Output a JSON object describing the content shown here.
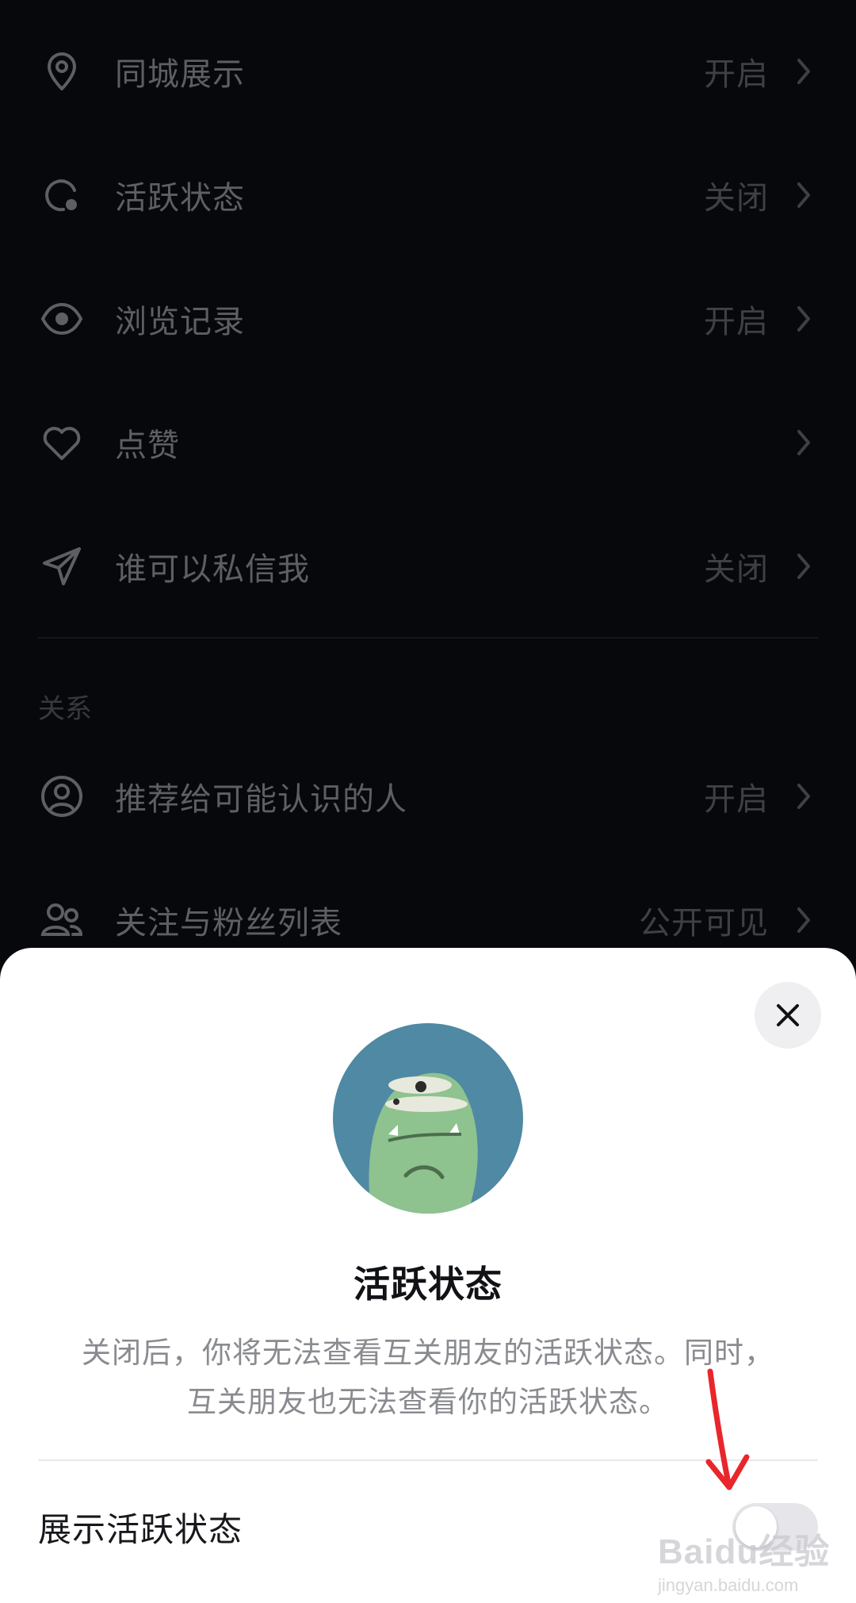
{
  "settings": {
    "rows": [
      {
        "label": "同城展示",
        "value": "开启",
        "icon": "location-pin-icon"
      },
      {
        "label": "活跃状态",
        "value": "关闭",
        "icon": "activity-status-icon"
      },
      {
        "label": "浏览记录",
        "value": "开启",
        "icon": "eye-icon"
      },
      {
        "label": "点赞",
        "value": "",
        "icon": "heart-icon"
      },
      {
        "label": "谁可以私信我",
        "value": "关闭",
        "icon": "paper-plane-icon"
      }
    ],
    "relations_section": "关系",
    "relations_rows": [
      {
        "label": "推荐给可能认识的人",
        "value": "开启",
        "icon": "user-circle-icon"
      },
      {
        "label": "关注与粉丝列表",
        "value": "公开可见",
        "icon": "users-icon"
      }
    ]
  },
  "sheet": {
    "title": "活跃状态",
    "description_line1": "关闭后，你将无法查看互关朋友的活跃状态。同时，",
    "description_line2": "互关朋友也无法查看你的活跃状态。",
    "toggle_label": "展示活跃状态",
    "toggle_on": false
  },
  "watermark": {
    "main": "Baidu经验",
    "sub": "jingyan.baidu.com"
  },
  "colors": {
    "background": "#07080b",
    "sheet": "#ffffff",
    "arrow": "#e8262b",
    "avatar_bg": "#4f89a3",
    "avatar_figure": "#8ec28f"
  }
}
